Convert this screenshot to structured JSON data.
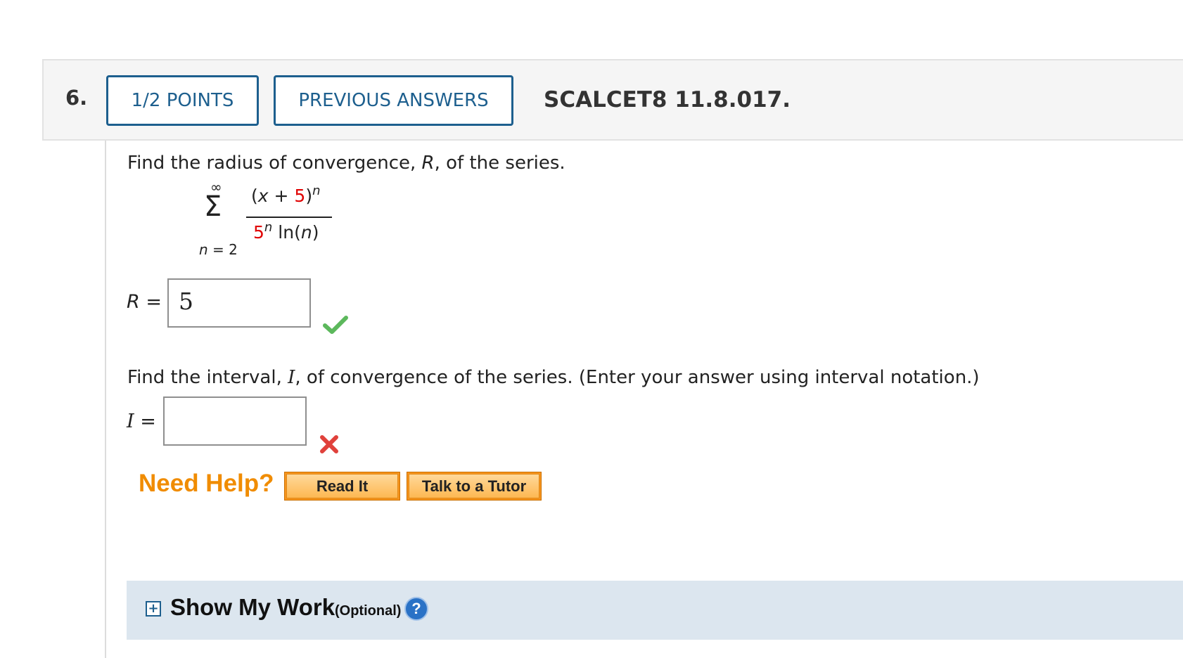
{
  "question": {
    "number": "6.",
    "points_label": "1/2 POINTS",
    "previous_answers_label": "PREVIOUS ANSWERS",
    "problem_id": "SCALCET8 11.8.017."
  },
  "part1": {
    "prompt_before": "Find the radius of convergence, ",
    "prompt_var": "R",
    "prompt_after": ", of the series.",
    "answer_label_var": "R",
    "answer_label_eq": " =",
    "answer_value": "5",
    "status": "correct"
  },
  "series": {
    "upper_limit": "∞",
    "sigma": "Σ",
    "lower_index": "n",
    "lower_rest": " = 2",
    "num_open": "(",
    "num_var": "x",
    "num_plus": " + ",
    "num_const": "5",
    "num_close": ")",
    "num_exp": "n",
    "den_base": "5",
    "den_exp": "n",
    "den_func": " ln(",
    "den_var": "n",
    "den_close": ")"
  },
  "part2": {
    "prompt_before": "Find the interval, ",
    "prompt_var": "I",
    "prompt_after": ", of convergence of the series. (Enter your answer using interval notation.)",
    "answer_label_var": "I",
    "answer_label_eq": " =",
    "answer_value": "",
    "status": "incorrect"
  },
  "help": {
    "need_help_label": "Need Help?",
    "read_it_label": "Read It",
    "talk_to_tutor_label": "Talk to a Tutor"
  },
  "show_work": {
    "expand_symbol": "+",
    "title": "Show My Work",
    "optional_label": "(Optional)",
    "help_symbol": "?"
  },
  "colors": {
    "accent_blue": "#1d5f8e",
    "need_help_orange": "#f08c00",
    "correct_green": "#5cb85c",
    "incorrect_red": "#e0413b",
    "highlight_red": "#e00000"
  }
}
